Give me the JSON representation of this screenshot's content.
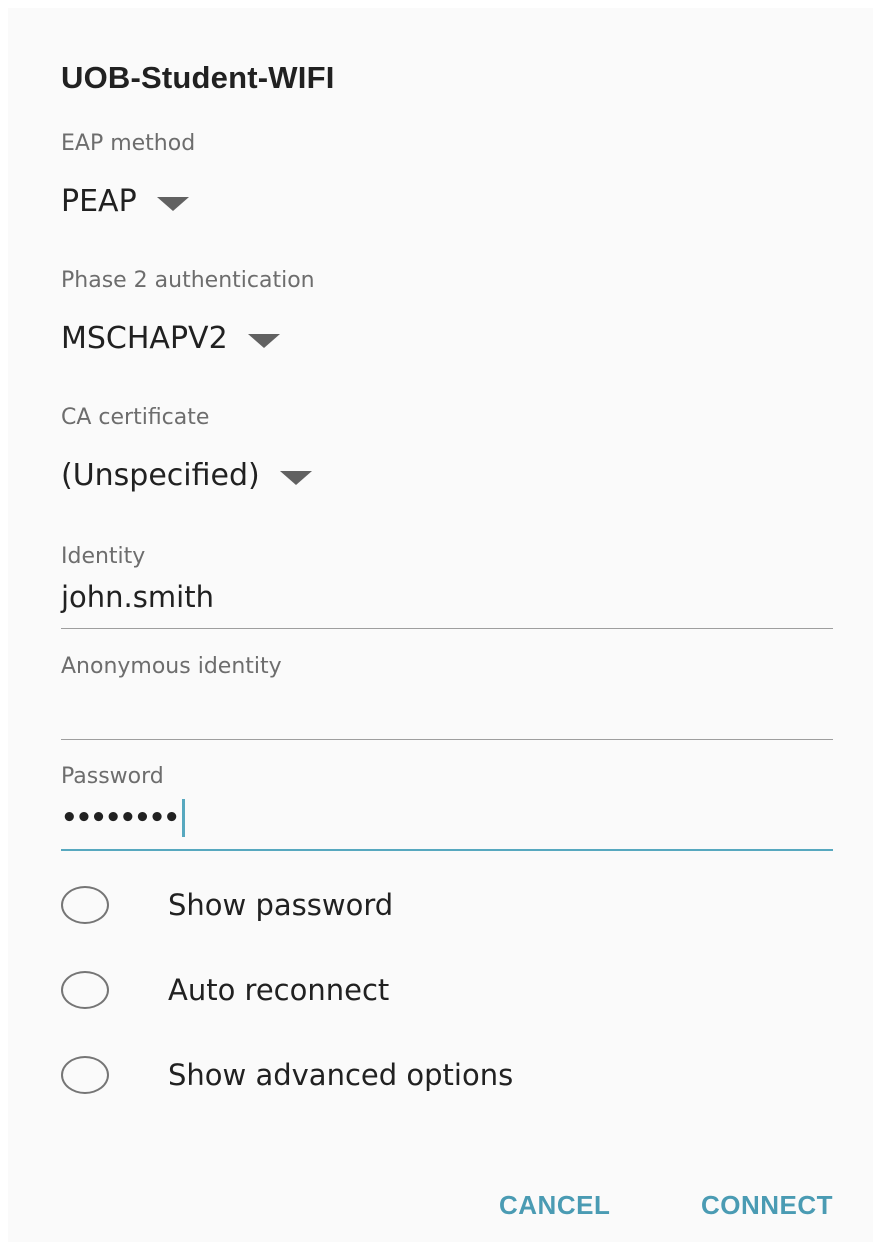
{
  "dialog": {
    "title": "UOB-Student-WIFI",
    "eap_method": {
      "label": "EAP method",
      "value": "PEAP"
    },
    "phase2": {
      "label": "Phase 2 authentication",
      "value": "MSCHAPV2"
    },
    "ca_certificate": {
      "label": "CA certificate",
      "value": "(Unspecified)"
    },
    "identity": {
      "label": "Identity",
      "value": "john.smith"
    },
    "anonymous_identity": {
      "label": "Anonymous identity",
      "value": ""
    },
    "password": {
      "label": "Password",
      "value": "••••••••"
    },
    "options": [
      {
        "label": "Show password",
        "checked": false
      },
      {
        "label": "Auto reconnect",
        "checked": false
      },
      {
        "label": "Show advanced options",
        "checked": false
      }
    ],
    "buttons": {
      "cancel": "CANCEL",
      "connect": "CONNECT"
    }
  },
  "colors": {
    "accent": "#4a9bb3",
    "text": "#212121",
    "secondary_text": "#6d6d6d",
    "background": "#fafafa"
  }
}
